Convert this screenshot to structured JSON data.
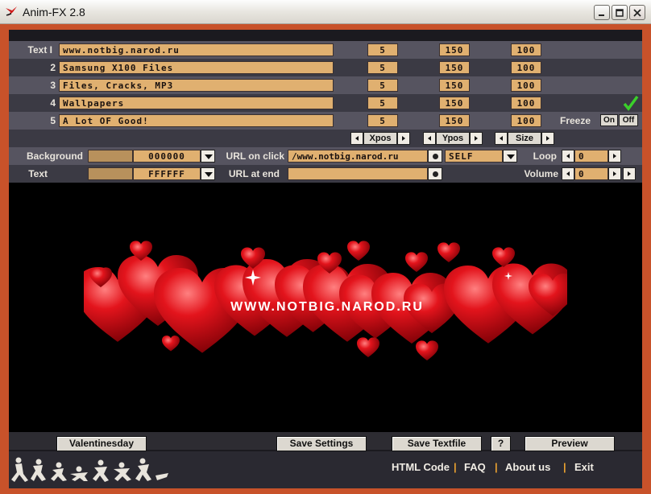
{
  "window": {
    "title": "Anim-FX 2.8"
  },
  "text_rows": [
    {
      "label": "Text I",
      "text": "www.notbig.narod.ru",
      "xpos": "5",
      "ypos": "150",
      "size": "100"
    },
    {
      "label": "2",
      "text": "Samsung X100 Files",
      "xpos": "5",
      "ypos": "150",
      "size": "100"
    },
    {
      "label": "3",
      "text": "Files, Cracks, MP3",
      "xpos": "5",
      "ypos": "150",
      "size": "100"
    },
    {
      "label": "4",
      "text": "Wallpapers",
      "xpos": "5",
      "ypos": "150",
      "size": "100"
    },
    {
      "label": "5",
      "text": "A Lot OF Good!",
      "xpos": "5",
      "ypos": "150",
      "size": "100"
    }
  ],
  "freeze": {
    "label": "Freeze",
    "on": "On",
    "off": "Off"
  },
  "adjusters": {
    "xpos": "Xpos",
    "ypos": "Ypos",
    "size": "Size"
  },
  "background": {
    "label": "Background",
    "value": "000000"
  },
  "text_color": {
    "label": "Text",
    "value": "FFFFFF"
  },
  "url_on_click": {
    "label": "URL on click",
    "value": "/www.notbig.narod.ru",
    "target": "SELF"
  },
  "url_at_end": {
    "label": "URL at end",
    "value": ""
  },
  "loop": {
    "label": "Loop",
    "value": "0"
  },
  "volume": {
    "label": "Volume",
    "value": "0"
  },
  "preview": {
    "banner_text": "WWW.NOTBIG.NAROD.RU"
  },
  "buttons": {
    "preset": "Valentinesday",
    "save_settings": "Save Settings",
    "save_textfile": "Save Textfile",
    "help": "?",
    "preview": "Preview"
  },
  "footer": {
    "html_code": "HTML Code",
    "faq": "FAQ",
    "about": "About us",
    "exit": "Exit",
    "separator": "|"
  },
  "colors": {
    "accent": "#c8522a",
    "field": "#e0b070",
    "heart": "#d8121a"
  }
}
